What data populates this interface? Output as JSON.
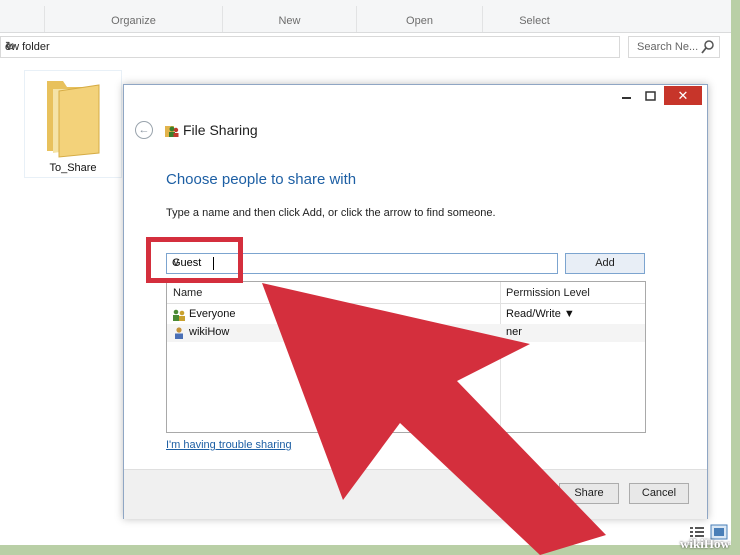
{
  "ribbon": {
    "groups": [
      "Organize",
      "New",
      "Open",
      "Select"
    ]
  },
  "address": {
    "path": "ew folder",
    "search_placeholder": "Search Ne..."
  },
  "folder": {
    "name": "To_Share"
  },
  "dialog": {
    "title": "File Sharing",
    "heading": "Choose people to share with",
    "instruction": "Type a name and then click Add, or click the arrow to find someone.",
    "input_value": "Guest",
    "add_label": "Add",
    "columns": [
      "Name",
      "Permission Level"
    ],
    "rows": [
      {
        "name": "Everyone",
        "permission": "Read/Write ▼"
      },
      {
        "name": "wikiHow",
        "permission": "ner"
      }
    ],
    "trouble_link": "I'm having trouble sharing",
    "share_label": "Share",
    "cancel_label": "Cancel"
  },
  "titlebar": {
    "close_glyph": "✕"
  },
  "watermark": "wikiHow",
  "colors": {
    "accent_blue": "#1d5fa4",
    "annotation_red": "#d42f3d",
    "close_red": "#c7352a"
  },
  "icons": [
    "back-arrow-icon",
    "share-people-icon",
    "folder-icon",
    "search-icon",
    "refresh-icon",
    "group-icon",
    "user-icon"
  ]
}
